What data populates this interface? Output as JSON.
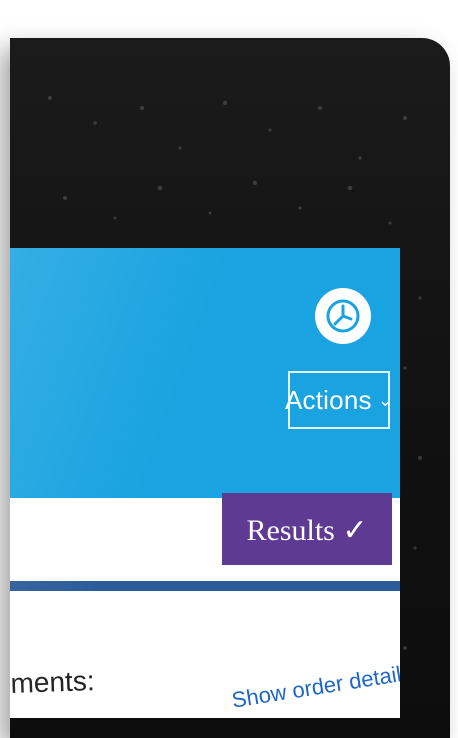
{
  "screen": {
    "actions": {
      "label": "Actions",
      "chevron": "⌄"
    },
    "results": {
      "label": "Results ✓"
    },
    "comments_label": "ments:",
    "order_link": "Show order details"
  },
  "colors": {
    "device": "#111111",
    "top_band": "#19a3e0",
    "results_bg": "#5e3a93",
    "rule": "#2c5b9a",
    "link": "#1d67c9"
  },
  "icons": {
    "clock": "clock-icon"
  }
}
